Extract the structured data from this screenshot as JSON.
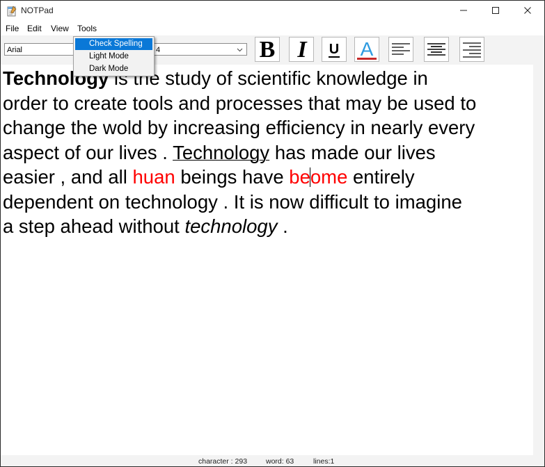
{
  "window": {
    "title": "NOTPad",
    "minimize_icon": "minimize-icon",
    "maximize_icon": "maximize-icon",
    "close_icon": "close-icon"
  },
  "menu": {
    "items": [
      {
        "label": "File"
      },
      {
        "label": "Edit"
      },
      {
        "label": "View"
      },
      {
        "label": "Tools"
      }
    ],
    "tools_dropdown": [
      {
        "label": "Check Spelling",
        "selected": true
      },
      {
        "label": "Light Mode",
        "selected": false
      },
      {
        "label": "Dark Mode",
        "selected": false
      }
    ]
  },
  "toolbar": {
    "font_family": "Arial",
    "font_size": "4",
    "buttons": [
      {
        "name": "bold-button",
        "icon": "bold-icon",
        "label": "B"
      },
      {
        "name": "italic-button",
        "icon": "italic-icon",
        "label": "I"
      },
      {
        "name": "underline-button",
        "icon": "underline-icon",
        "label": "U"
      },
      {
        "name": "font-color-button",
        "icon": "font-color-icon",
        "label": "A"
      },
      {
        "name": "align-left-button",
        "icon": "align-left-icon"
      },
      {
        "name": "align-center-button",
        "icon": "align-center-icon"
      },
      {
        "name": "align-right-button",
        "icon": "align-right-icon"
      }
    ],
    "font_color": "#c62828",
    "font_color_letter": "#2e9be0"
  },
  "document": {
    "l1_bold": "Technology",
    "l1_rest": " is the study of scientific knowledge in",
    "l2": "order to create tools and processes that may be used to",
    "l3": "change the wold by increasing efficiency in nearly every",
    "l4_a": "aspect of our lives . ",
    "l4_underlined": "Technology",
    "l4_b": " has made our lives",
    "l5_a": "easier , and all ",
    "l5_miss1": "huan",
    "l5_b": " beings have ",
    "l5_miss2a": "be",
    "l5_miss2b": "ome",
    "l5_c": " entirely",
    "l6": "dependent on technology . It is now difficult to imagine",
    "l7_a": "a step ahead without ",
    "l7_italic": "technology",
    "l7_b": " .",
    "misspelled_color": "#ff0000"
  },
  "status": {
    "characters": "character : 293",
    "words": "word: 63",
    "lines": "lines:1"
  }
}
